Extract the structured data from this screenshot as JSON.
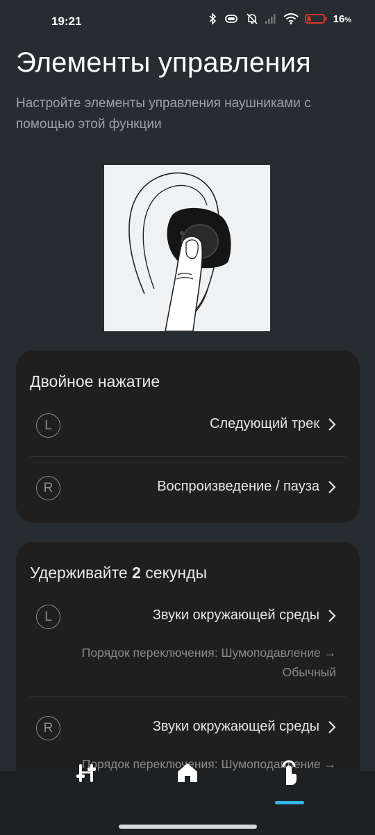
{
  "status_bar": {
    "time": "19:21",
    "battery_percent": "16",
    "battery_symbol": "%"
  },
  "header": {
    "title": "Элементы управления",
    "subtitle": "Настройте элементы управления наушниками с помощью этой функции"
  },
  "double_tap": {
    "title": "Двойное нажатие",
    "left": {
      "badge": "L",
      "action": "Следующий трек"
    },
    "right": {
      "badge": "R",
      "action": "Воспроизведение / пауза"
    }
  },
  "hold": {
    "title_prefix": "Удерживайте",
    "title_number": "2",
    "title_suffix": "секунды",
    "left": {
      "badge": "L",
      "action": "Звуки окружающей среды",
      "detail": "Порядок переключения: Шумоподавление → Обычный"
    },
    "right": {
      "badge": "R",
      "action": "Звуки окружающей среды",
      "detail": "Порядок переключения: Шумоподавление →"
    }
  },
  "bottom_nav": {
    "items": [
      "equalizer-icon",
      "home-icon",
      "touch-controls-icon"
    ],
    "active_index": 2
  },
  "colors": {
    "background": "#262c30",
    "card": "#1f1f1f",
    "accent": "#33b5e5",
    "battery_low": "#e0302b"
  }
}
